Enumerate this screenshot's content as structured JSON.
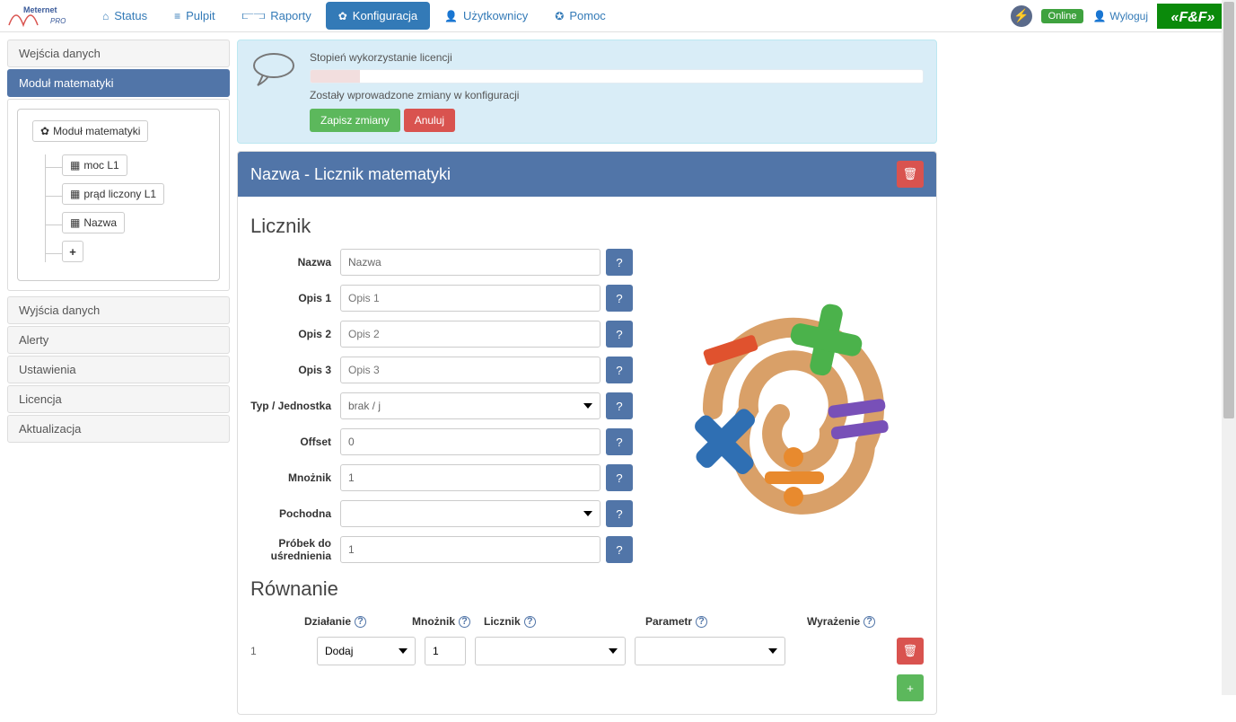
{
  "nav": {
    "status": "Status",
    "pulpit": "Pulpit",
    "raporty": "Raporty",
    "konfiguracja": "Konfiguracja",
    "uzytkownicy": "Użytkownicy",
    "pomoc": "Pomoc"
  },
  "topbar": {
    "online": "Online",
    "logout": "Wyloguj"
  },
  "sidebar": {
    "wejscia": "Wejścia danych",
    "modul": "Moduł matematyki",
    "wyjscia": "Wyjścia danych",
    "alerty": "Alerty",
    "ustawienia": "Ustawienia",
    "licencja": "Licencja",
    "aktualizacja": "Aktualizacja",
    "tree": {
      "root": "Moduł matematyki",
      "child1": "moc L1",
      "child2": "prąd liczony L1",
      "child3": "Nazwa",
      "add": "+"
    }
  },
  "alert": {
    "title": "Stopień wykorzystanie licencji",
    "changes": "Zostały wprowadzone zmiany w konfiguracji",
    "save": "Zapisz zmiany",
    "cancel": "Anuluj"
  },
  "panel": {
    "header": "Nazwa - Licznik matematyki",
    "section_licznik": "Licznik",
    "labels": {
      "nazwa": "Nazwa",
      "opis1": "Opis 1",
      "opis2": "Opis 2",
      "opis3": "Opis 3",
      "typ": "Typ / Jednostka",
      "offset": "Offset",
      "mnoznik": "Mnożnik",
      "pochodna": "Pochodna",
      "probek": "Próbek do uśrednienia"
    },
    "values": {
      "nazwa": "Nazwa",
      "typ": "brak / j",
      "offset": "0",
      "mnoznik": "1",
      "pochodna": "",
      "probek": "1"
    },
    "placeholders": {
      "opis1": "Opis 1",
      "opis2": "Opis 2",
      "opis3": "Opis 3"
    },
    "help": "?",
    "section_rownanie": "Równanie",
    "th": {
      "dzialanie": "Działanie",
      "mnoznik": "Mnożnik",
      "licznik": "Licznik",
      "parametr": "Parametr",
      "wyrazenie": "Wyrażenie"
    },
    "row": {
      "num": "1",
      "dzialanie": "Dodaj",
      "mnoznik": "1"
    }
  }
}
